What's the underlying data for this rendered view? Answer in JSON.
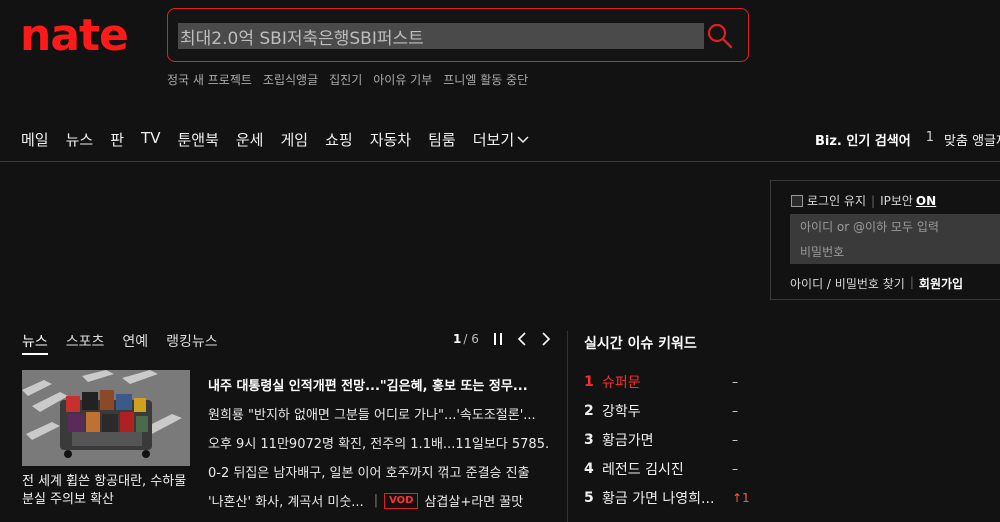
{
  "brand": {
    "logo": "nate",
    "accent": "#ff1a1a"
  },
  "search": {
    "value": "최대2.0억 SBI저축은행SBI퍼스트"
  },
  "hot_links": [
    "정국 새 프로젝트",
    "조립식앵글",
    "집진기",
    "아이유 기부",
    "프니엘 활동 중단"
  ],
  "nav": {
    "items": [
      "메일",
      "뉴스",
      "판",
      "TV",
      "툰앤북",
      "운세",
      "게임",
      "쇼핑",
      "자동차",
      "팀룸"
    ],
    "more": "더보기"
  },
  "biz": {
    "label": "Biz. 인기 검색어",
    "rank": "1",
    "keyword": "맞춤 앵글제"
  },
  "login": {
    "keep": "로그인 유지",
    "ip": "IP보안",
    "ip_state": "ON",
    "id_placeholder": "아이디 or @이하 모두 입력",
    "pw_placeholder": "비밀번호",
    "find": "아이디 / 비밀번호 찾기",
    "join": "회원가입"
  },
  "news": {
    "tabs": [
      "뉴스",
      "스포츠",
      "연예",
      "랭킹뉴스"
    ],
    "page_current": "1",
    "page_total": "/ 6",
    "thumb_caption": "전 세계 휩쓴 항공대란, 수하물 분실 주의보 확산",
    "headlines": [
      "내주 대통령실 인적개편 전망...\"김은혜, 홍보 또는 정무...",
      "원희룡 \"반지하 없애면 그분들 어디로 가나\"...'속도조절론'...",
      "오후 9시 11만9072명 확진, 전주의 1.1배...11일보다 5785...",
      "0-2 뒤집은 남자배구, 일본 이어 호주까지 꺾고 준결승 진출"
    ],
    "last_left": "'나혼산' 화사, 계곡서 미숫...",
    "vod_label": "VOD",
    "last_right": "삼겹살+라면 꿀맛"
  },
  "issues": {
    "title": "실시간 이슈 키워드",
    "items": [
      {
        "rank": "1",
        "name": "슈퍼문",
        "change": "–"
      },
      {
        "rank": "2",
        "name": "강학두",
        "change": "–"
      },
      {
        "rank": "3",
        "name": "황금가면",
        "change": "–"
      },
      {
        "rank": "4",
        "name": "레전드 김시진",
        "change": "–"
      },
      {
        "rank": "5",
        "name": "황금 가면 나영희...",
        "change": "↑1"
      }
    ]
  }
}
